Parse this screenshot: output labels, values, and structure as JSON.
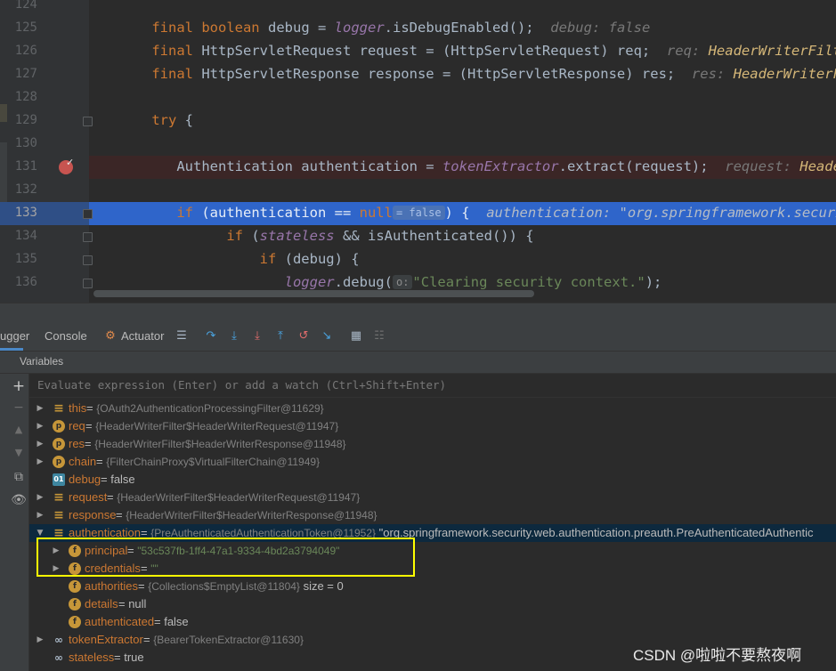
{
  "editor": {
    "lines": [
      {
        "num": "124",
        "text": ""
      },
      {
        "num": "125",
        "text": "final boolean debug = logger.isDebugEnabled();",
        "hint": "debug: false"
      },
      {
        "num": "126",
        "text": "final HttpServletRequest request = (HttpServletRequest) req;",
        "hint": "req: HeaderWriterFilte"
      },
      {
        "num": "127",
        "text": "final HttpServletResponse response = (HttpServletResponse) res;",
        "hint": "res: HeaderWriterFi"
      },
      {
        "num": "128",
        "text": ""
      },
      {
        "num": "129",
        "text": "try {"
      },
      {
        "num": "130",
        "text": ""
      },
      {
        "num": "131",
        "text": "Authentication authentication = tokenExtractor.extract(request);",
        "hint": "request: Heade"
      },
      {
        "num": "132",
        "text": ""
      },
      {
        "num": "133",
        "text": "if (authentication == null",
        "inline": "= false",
        "text2": ") {",
        "hint": "authentication: \"org.springframework.securi"
      },
      {
        "num": "134",
        "text": "if (stateless && isAuthenticated()) {"
      },
      {
        "num": "135",
        "text": "if (debug) {"
      },
      {
        "num": "136",
        "text": "logger.debug(",
        "inline": "o:",
        "text2": "\"Clearing security context.\");"
      }
    ]
  },
  "toolbar": {
    "debugger_tab": "ugger",
    "console_tab": "Console",
    "actuator_tab": "Actuator"
  },
  "variables": {
    "header": "Variables",
    "watch_placeholder": "Evaluate expression (Enter) or add a watch (Ctrl+Shift+Enter)",
    "rows": [
      {
        "name": "this",
        "rest": " = ",
        "type": "{OAuth2AuthenticationProcessingFilter@11629}"
      },
      {
        "name": "req",
        "rest": " = ",
        "type": "{HeaderWriterFilter$HeaderWriterRequest@11947}"
      },
      {
        "name": "res",
        "rest": " = ",
        "type": "{HeaderWriterFilter$HeaderWriterResponse@11948}"
      },
      {
        "name": "chain",
        "rest": " = ",
        "type": "{FilterChainProxy$VirtualFilterChain@11949}"
      },
      {
        "name": "debug",
        "rest": " = false",
        "type": ""
      },
      {
        "name": "request",
        "rest": " = ",
        "type": "{HeaderWriterFilter$HeaderWriterRequest@11947}"
      },
      {
        "name": "response",
        "rest": " = ",
        "type": "{HeaderWriterFilter$HeaderWriterResponse@11948}"
      },
      {
        "name": "authentication",
        "rest": " = ",
        "type": "{PreAuthenticatedAuthenticationToken@11952}",
        "extra": " \"org.springframework.security.web.authentication.preauth.PreAuthenticatedAuthentic"
      },
      {
        "name": "principal",
        "rest": " = ",
        "value": "\"53c537fb-1ff4-47a1-9334-4bd2a3794049\""
      },
      {
        "name": "credentials",
        "rest": " = ",
        "value": "\"\""
      },
      {
        "name": "authorities",
        "rest": " = ",
        "type": "{Collections$EmptyList@11804}",
        "extra": "  size = 0"
      },
      {
        "name": "details",
        "rest": " = null",
        "type": ""
      },
      {
        "name": "authenticated",
        "rest": " = false",
        "type": ""
      },
      {
        "name": "tokenExtractor",
        "rest": " = ",
        "type": "{BearerTokenExtractor@11630}"
      },
      {
        "name": "stateless",
        "rest": " = true",
        "type": ""
      }
    ]
  },
  "watermark": "CSDN @啦啦不要熬夜啊"
}
